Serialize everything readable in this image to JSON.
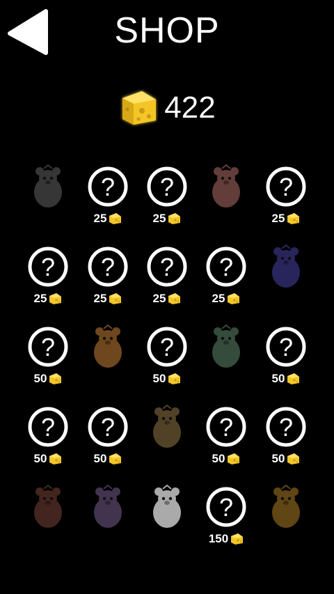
{
  "header": {
    "title": "SHOP"
  },
  "wallet": {
    "amount": "422"
  },
  "items": [
    {
      "state": "owned",
      "color": "#3c3c3c",
      "price": ""
    },
    {
      "state": "locked",
      "price": "25"
    },
    {
      "state": "locked",
      "price": "25"
    },
    {
      "state": "owned",
      "color": "#6e4440",
      "price": ""
    },
    {
      "state": "locked",
      "price": "25"
    },
    {
      "state": "locked",
      "price": "25"
    },
    {
      "state": "locked",
      "price": "25"
    },
    {
      "state": "locked",
      "price": "25"
    },
    {
      "state": "locked",
      "price": "25"
    },
    {
      "state": "owned",
      "color": "#2d2a66",
      "price": ""
    },
    {
      "state": "locked",
      "price": "50"
    },
    {
      "state": "owned",
      "color": "#7a4f22",
      "price": ""
    },
    {
      "state": "locked",
      "price": "50"
    },
    {
      "state": "owned",
      "color": "#3b5442",
      "price": ""
    },
    {
      "state": "locked",
      "price": "50"
    },
    {
      "state": "locked",
      "price": "50"
    },
    {
      "state": "locked",
      "price": "50"
    },
    {
      "state": "owned",
      "color": "#5a4a2c",
      "price": ""
    },
    {
      "state": "locked",
      "price": "50"
    },
    {
      "state": "locked",
      "price": "50"
    },
    {
      "state": "owned",
      "color": "#4a2a22",
      "price": ""
    },
    {
      "state": "owned",
      "color": "#4a3a58",
      "price": ""
    },
    {
      "state": "owned",
      "color": "#bdbdbd",
      "price": ""
    },
    {
      "state": "locked",
      "price": "150"
    },
    {
      "state": "owned",
      "color": "#6b4d18",
      "price": ""
    }
  ],
  "colors": {
    "cheese": "#f3c628",
    "cheese_shadow": "#c99a12",
    "background": "#000000"
  }
}
